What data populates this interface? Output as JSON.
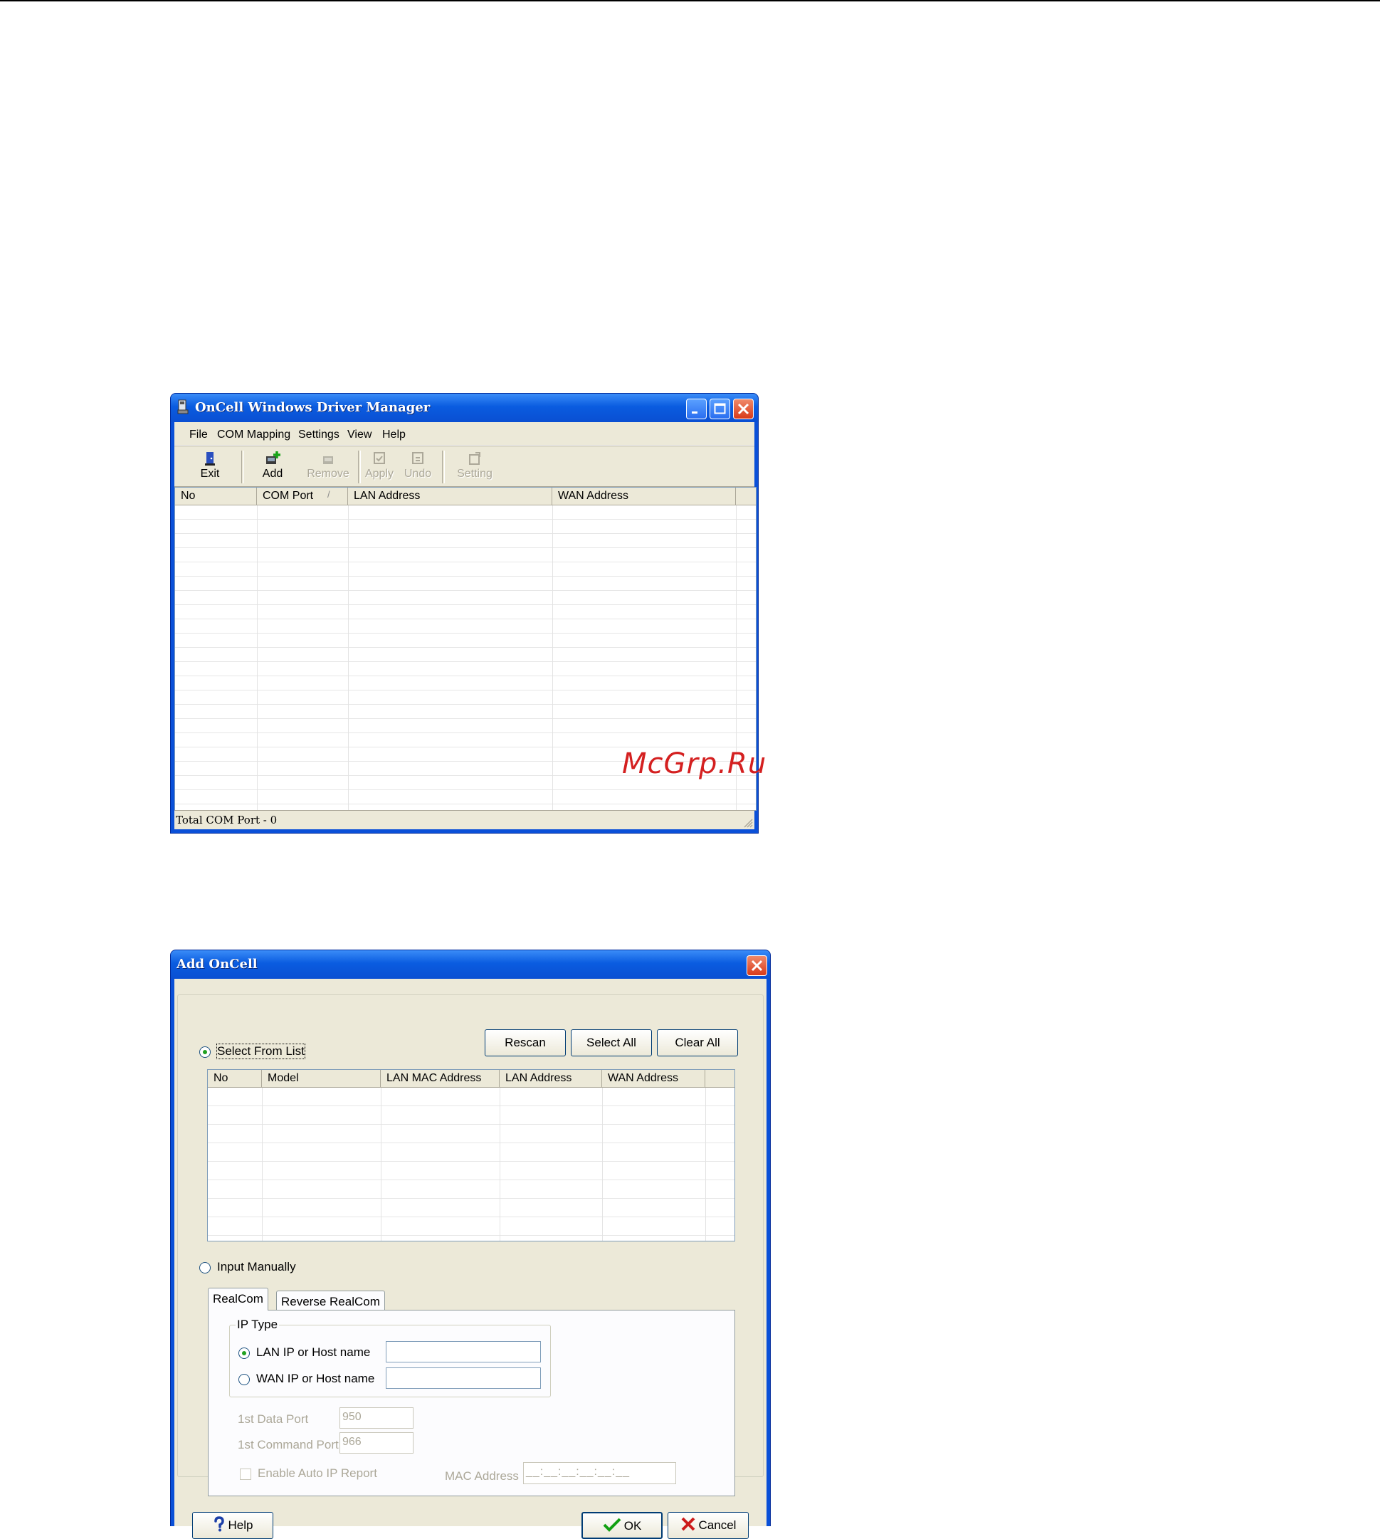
{
  "watermark": "McGrp.Ru",
  "main_window": {
    "title": "OnCell Windows Driver Manager",
    "menu": [
      "File",
      "COM Mapping",
      "Settings",
      "View",
      "Help"
    ],
    "toolbar": {
      "exit": "Exit",
      "add": "Add",
      "remove": "Remove",
      "apply": "Apply",
      "undo": "Undo",
      "setting": "Setting"
    },
    "columns": [
      "No",
      "COM Port",
      "LAN Address",
      "WAN Address"
    ],
    "sort_indicator": "/",
    "status": "Total COM Port - 0"
  },
  "dialog": {
    "title": "Add OnCell",
    "select_from_list": "Select From List",
    "buttons": {
      "rescan": "Rescan",
      "select_all": "Select All",
      "clear_all": "Clear All",
      "help": "Help",
      "ok": "OK",
      "cancel": "Cancel"
    },
    "columns": [
      "No",
      "Model",
      "LAN MAC Address",
      "LAN Address",
      "WAN Address"
    ],
    "input_manually": "Input Manually",
    "tabs": [
      "RealCom",
      "Reverse RealCom"
    ],
    "ip_type": {
      "title": "IP Type",
      "lan": "LAN IP or Host name",
      "wan": "WAN IP or Host name",
      "lan_value": "",
      "wan_value": ""
    },
    "data_port_label": "1st Data Port",
    "data_port_value": "950",
    "command_port_label": "1st Command Port",
    "command_port_value": "966",
    "auto_ip_label": "Enable Auto IP Report",
    "mac_label": "MAC Address",
    "mac_value": "__:__:__:__:__:__"
  }
}
